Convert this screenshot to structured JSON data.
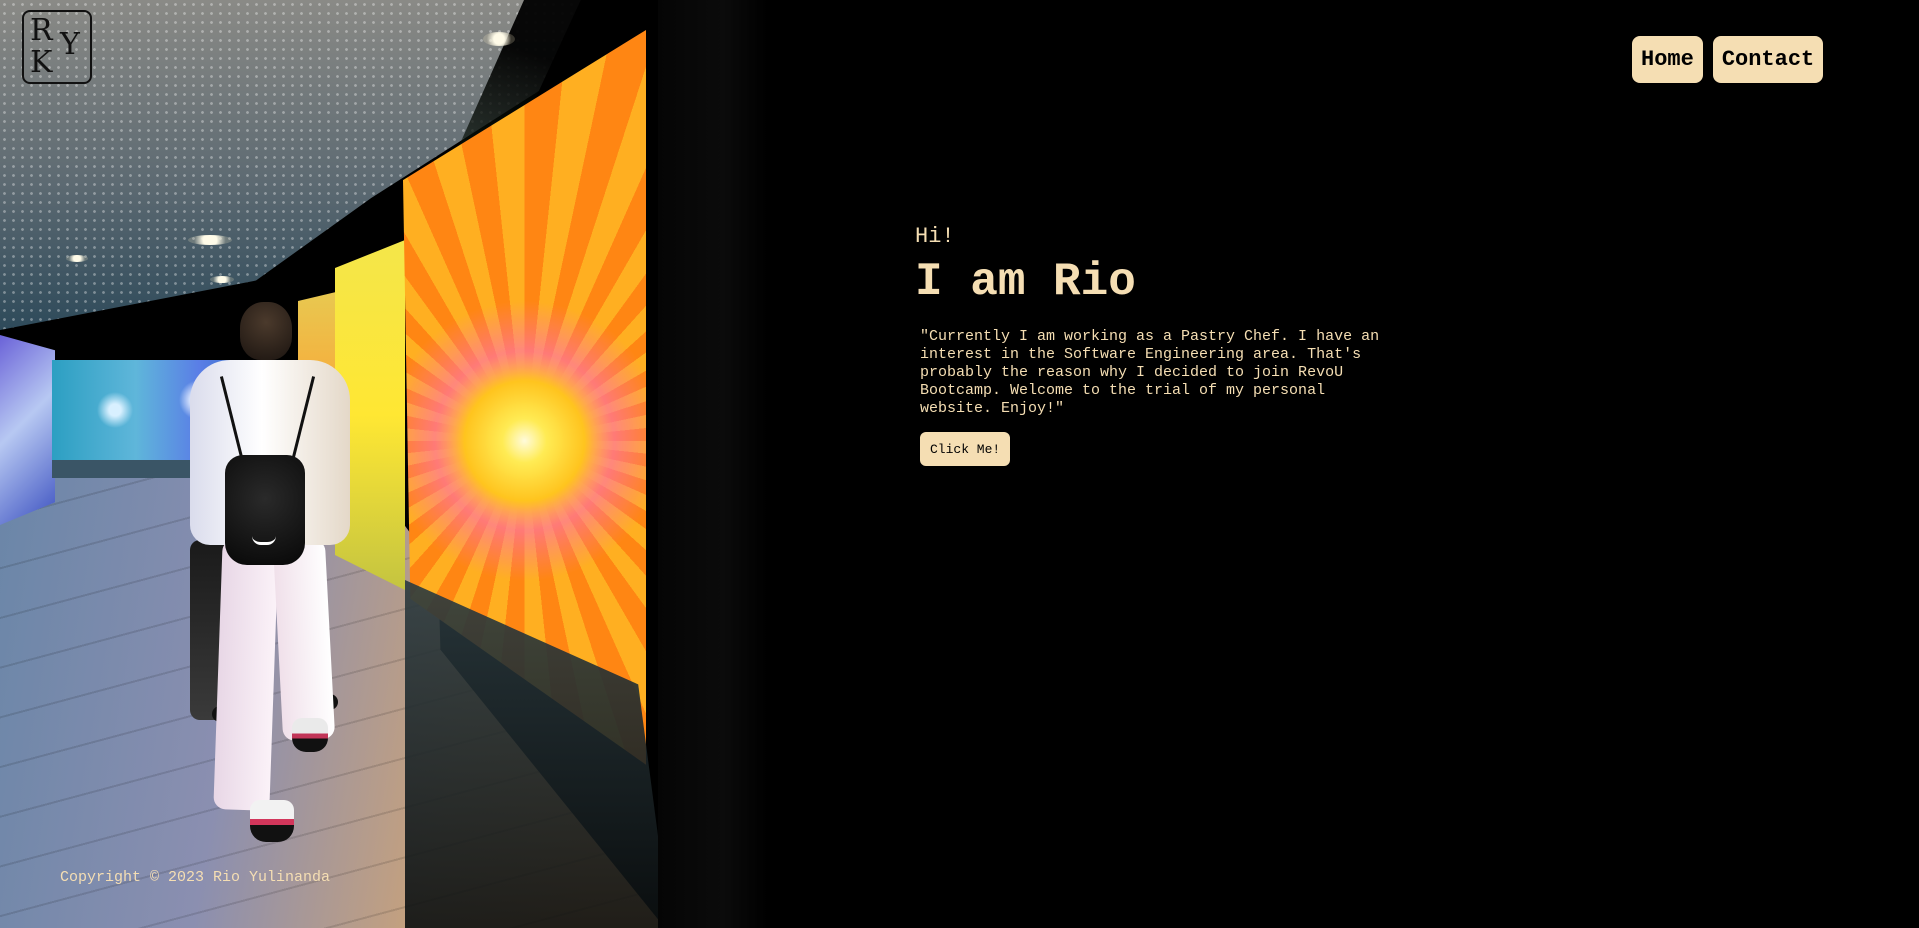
{
  "logo": {
    "letters": [
      "R",
      "Y",
      "K"
    ]
  },
  "nav": {
    "home_label": "Home",
    "contact_label": "Contact"
  },
  "hero": {
    "greeting": "Hi!",
    "name": "I am Rio",
    "bio": "\"Currently I am working as a Pastry Chef. I have an interest in the Software Engineering area. That's probably the reason why I decided to join RevoU Bootcamp. Welcome to the trial of my personal website. Enjoy!\"",
    "cta_label": "Click Me!"
  },
  "footer": {
    "copyright": "Copyright © 2023 Rio Yulinanda"
  },
  "colors": {
    "accent": "#f5deb3",
    "background": "#000000",
    "button_text": "#000000"
  },
  "background_image": {
    "icon": "photo-person-walking-flower-screens"
  }
}
